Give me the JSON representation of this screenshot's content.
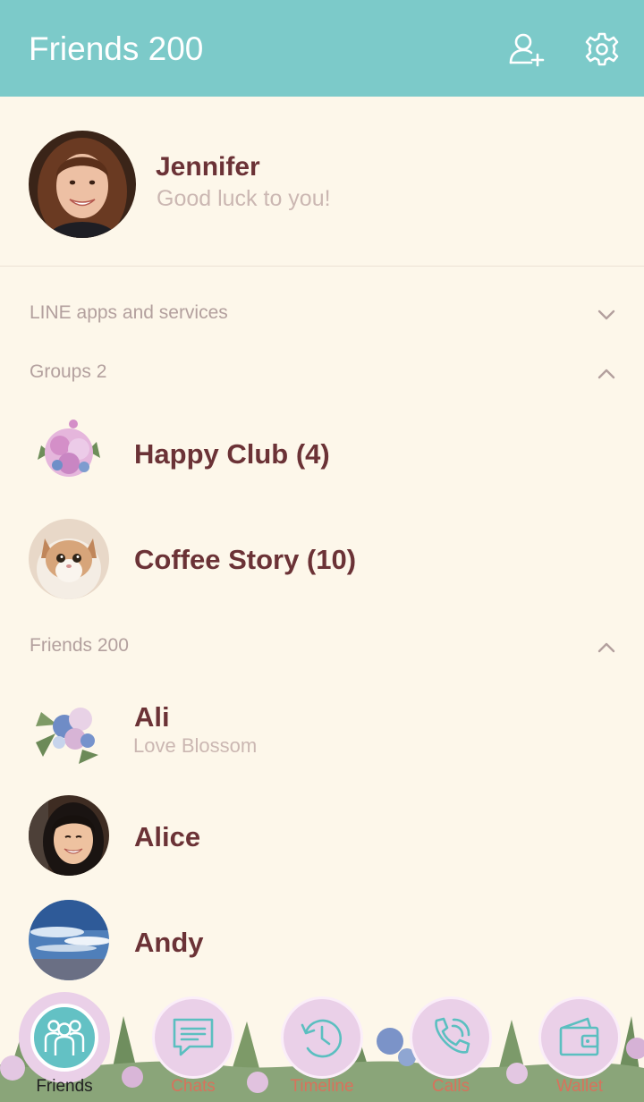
{
  "header": {
    "title": "Friends 200"
  },
  "profile": {
    "name": "Jennifer",
    "status": "Good luck to you!"
  },
  "sections": {
    "line_apps": "LINE apps and services",
    "groups": "Groups 2",
    "friends": "Friends 200"
  },
  "groups": [
    {
      "name": "Happy Club (4)"
    },
    {
      "name": "Coffee Story (10)"
    }
  ],
  "friends": [
    {
      "name": "Ali",
      "status": "Love Blossom"
    },
    {
      "name": "Alice"
    },
    {
      "name": "Andy"
    }
  ],
  "tabs": [
    {
      "label": "Friends",
      "active": true
    },
    {
      "label": "Chats"
    },
    {
      "label": "Timeline"
    },
    {
      "label": "Calls"
    },
    {
      "label": "Wallet"
    }
  ],
  "colors": {
    "header": "#7ccac9",
    "background": "#fdf7ea",
    "name_text": "#6b3236",
    "muted_text": "#b3a09e",
    "tab_label": "#d8725c"
  }
}
